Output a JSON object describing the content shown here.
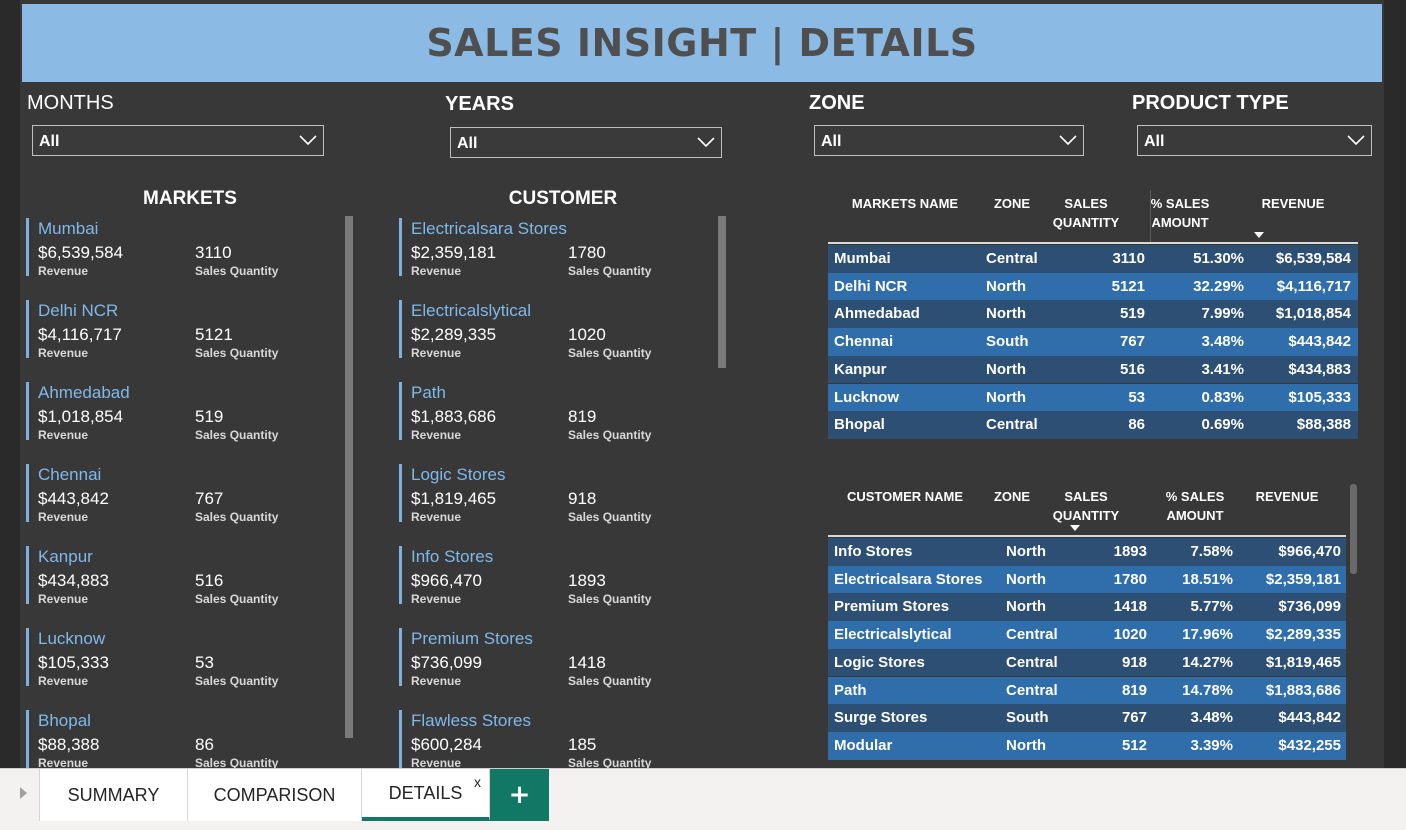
{
  "title": "SALES INSIGHT | DETAILS",
  "filters": {
    "months": {
      "label": "MONTHS",
      "value": "All"
    },
    "years": {
      "label": "YEARS",
      "value": "All"
    },
    "zone": {
      "label": "ZONE",
      "value": "All"
    },
    "product_type": {
      "label": "PRODUCT TYPE",
      "value": "All"
    }
  },
  "markets": {
    "title": "MARKETS",
    "revenue_label": "Revenue",
    "qty_label": "Sales Quantity",
    "items": [
      {
        "name": "Mumbai",
        "revenue": "$6,539,584",
        "qty": "3110"
      },
      {
        "name": "Delhi NCR",
        "revenue": "$4,116,717",
        "qty": "5121"
      },
      {
        "name": "Ahmedabad",
        "revenue": "$1,018,854",
        "qty": "519"
      },
      {
        "name": "Chennai",
        "revenue": "$443,842",
        "qty": "767"
      },
      {
        "name": "Kanpur",
        "revenue": "$434,883",
        "qty": "516"
      },
      {
        "name": "Lucknow",
        "revenue": "$105,333",
        "qty": "53"
      },
      {
        "name": "Bhopal",
        "revenue": "$88,388",
        "qty": "86"
      }
    ]
  },
  "customers": {
    "title": "CUSTOMER",
    "revenue_label": "Revenue",
    "qty_label": "Sales Quantity",
    "items": [
      {
        "name": "Electricalsara Stores",
        "revenue": "$2,359,181",
        "qty": "1780"
      },
      {
        "name": "Electricalslytical",
        "revenue": "$2,289,335",
        "qty": "1020"
      },
      {
        "name": "Path",
        "revenue": "$1,883,686",
        "qty": "819"
      },
      {
        "name": "Logic Stores",
        "revenue": "$1,819,465",
        "qty": "918"
      },
      {
        "name": "Info Stores",
        "revenue": "$966,470",
        "qty": "1893"
      },
      {
        "name": "Premium Stores",
        "revenue": "$736,099",
        "qty": "1418"
      },
      {
        "name": "Flawless Stores",
        "revenue": "$600,284",
        "qty": "185"
      }
    ]
  },
  "markets_table": {
    "headers": {
      "name": "MARKETS NAME",
      "zone": "ZONE",
      "qty1": "SALES",
      "qty2": "QUANTITY",
      "pct1": "% SALES",
      "pct2": "AMOUNT",
      "revenue": "REVENUE"
    },
    "rows": [
      [
        "Mumbai",
        "Central",
        "3110",
        "51.30%",
        "$6,539,584"
      ],
      [
        "Delhi NCR",
        "North",
        "5121",
        "32.29%",
        "$4,116,717"
      ],
      [
        "Ahmedabad",
        "North",
        "519",
        "7.99%",
        "$1,018,854"
      ],
      [
        "Chennai",
        "South",
        "767",
        "3.48%",
        "$443,842"
      ],
      [
        "Kanpur",
        "North",
        "516",
        "3.41%",
        "$434,883"
      ],
      [
        "Lucknow",
        "North",
        "53",
        "0.83%",
        "$105,333"
      ],
      [
        "Bhopal",
        "Central",
        "86",
        "0.69%",
        "$88,388"
      ]
    ]
  },
  "customers_table": {
    "headers": {
      "name": "CUSTOMER NAME",
      "zone": "ZONE",
      "qty1": "SALES",
      "qty2": "QUANTITY",
      "pct1": "% SALES",
      "pct2": "AMOUNT",
      "revenue": "REVENUE"
    },
    "rows": [
      [
        "Info Stores",
        "North",
        "1893",
        "7.58%",
        "$966,470"
      ],
      [
        "Electricalsara Stores",
        "North",
        "1780",
        "18.51%",
        "$2,359,181"
      ],
      [
        "Premium Stores",
        "North",
        "1418",
        "5.77%",
        "$736,099"
      ],
      [
        "Electricalslytical",
        "Central",
        "1020",
        "17.96%",
        "$2,289,335"
      ],
      [
        "Logic Stores",
        "Central",
        "918",
        "14.27%",
        "$1,819,465"
      ],
      [
        "Path",
        "Central",
        "819",
        "14.78%",
        "$1,883,686"
      ],
      [
        "Surge Stores",
        "South",
        "767",
        "3.48%",
        "$443,842"
      ],
      [
        "Modular",
        "North",
        "512",
        "3.39%",
        "$432,255"
      ]
    ]
  },
  "tabs": {
    "summary": "SUMMARY",
    "comparison": "COMPARISON",
    "details": "DETAILS",
    "close": "x",
    "add": "+"
  },
  "colors": {
    "title_bg": "#8bbbe4",
    "canvas_bg": "#383838",
    "row_dark": "#2d4f73",
    "row_light": "#2f6eab",
    "accent": "#117865"
  },
  "icons": [
    "chevron-down-icon",
    "plus-icon",
    "close-icon",
    "caret-right-icon",
    "sort-down-icon"
  ]
}
